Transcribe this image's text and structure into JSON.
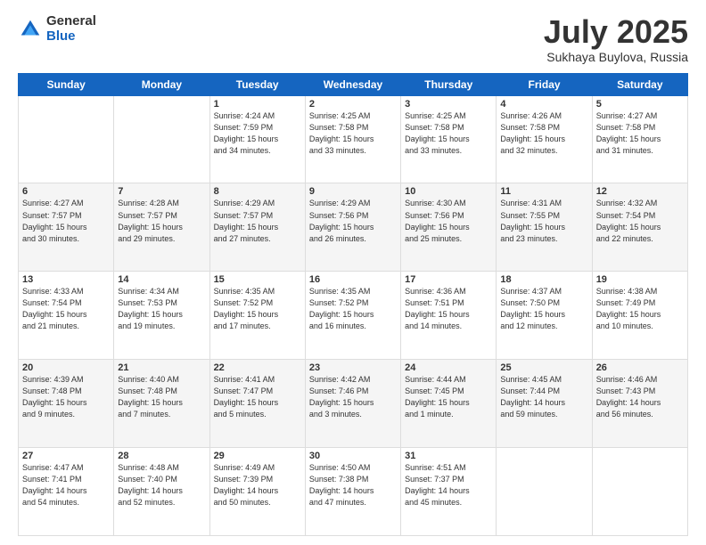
{
  "header": {
    "logo_general": "General",
    "logo_blue": "Blue",
    "month": "July 2025",
    "location": "Sukhaya Buylova, Russia"
  },
  "days_of_week": [
    "Sunday",
    "Monday",
    "Tuesday",
    "Wednesday",
    "Thursday",
    "Friday",
    "Saturday"
  ],
  "weeks": [
    [
      {
        "day": "",
        "info": ""
      },
      {
        "day": "",
        "info": ""
      },
      {
        "day": "1",
        "info": "Sunrise: 4:24 AM\nSunset: 7:59 PM\nDaylight: 15 hours\nand 34 minutes."
      },
      {
        "day": "2",
        "info": "Sunrise: 4:25 AM\nSunset: 7:58 PM\nDaylight: 15 hours\nand 33 minutes."
      },
      {
        "day": "3",
        "info": "Sunrise: 4:25 AM\nSunset: 7:58 PM\nDaylight: 15 hours\nand 33 minutes."
      },
      {
        "day": "4",
        "info": "Sunrise: 4:26 AM\nSunset: 7:58 PM\nDaylight: 15 hours\nand 32 minutes."
      },
      {
        "day": "5",
        "info": "Sunrise: 4:27 AM\nSunset: 7:58 PM\nDaylight: 15 hours\nand 31 minutes."
      }
    ],
    [
      {
        "day": "6",
        "info": "Sunrise: 4:27 AM\nSunset: 7:57 PM\nDaylight: 15 hours\nand 30 minutes."
      },
      {
        "day": "7",
        "info": "Sunrise: 4:28 AM\nSunset: 7:57 PM\nDaylight: 15 hours\nand 29 minutes."
      },
      {
        "day": "8",
        "info": "Sunrise: 4:29 AM\nSunset: 7:57 PM\nDaylight: 15 hours\nand 27 minutes."
      },
      {
        "day": "9",
        "info": "Sunrise: 4:29 AM\nSunset: 7:56 PM\nDaylight: 15 hours\nand 26 minutes."
      },
      {
        "day": "10",
        "info": "Sunrise: 4:30 AM\nSunset: 7:56 PM\nDaylight: 15 hours\nand 25 minutes."
      },
      {
        "day": "11",
        "info": "Sunrise: 4:31 AM\nSunset: 7:55 PM\nDaylight: 15 hours\nand 23 minutes."
      },
      {
        "day": "12",
        "info": "Sunrise: 4:32 AM\nSunset: 7:54 PM\nDaylight: 15 hours\nand 22 minutes."
      }
    ],
    [
      {
        "day": "13",
        "info": "Sunrise: 4:33 AM\nSunset: 7:54 PM\nDaylight: 15 hours\nand 21 minutes."
      },
      {
        "day": "14",
        "info": "Sunrise: 4:34 AM\nSunset: 7:53 PM\nDaylight: 15 hours\nand 19 minutes."
      },
      {
        "day": "15",
        "info": "Sunrise: 4:35 AM\nSunset: 7:52 PM\nDaylight: 15 hours\nand 17 minutes."
      },
      {
        "day": "16",
        "info": "Sunrise: 4:35 AM\nSunset: 7:52 PM\nDaylight: 15 hours\nand 16 minutes."
      },
      {
        "day": "17",
        "info": "Sunrise: 4:36 AM\nSunset: 7:51 PM\nDaylight: 15 hours\nand 14 minutes."
      },
      {
        "day": "18",
        "info": "Sunrise: 4:37 AM\nSunset: 7:50 PM\nDaylight: 15 hours\nand 12 minutes."
      },
      {
        "day": "19",
        "info": "Sunrise: 4:38 AM\nSunset: 7:49 PM\nDaylight: 15 hours\nand 10 minutes."
      }
    ],
    [
      {
        "day": "20",
        "info": "Sunrise: 4:39 AM\nSunset: 7:48 PM\nDaylight: 15 hours\nand 9 minutes."
      },
      {
        "day": "21",
        "info": "Sunrise: 4:40 AM\nSunset: 7:48 PM\nDaylight: 15 hours\nand 7 minutes."
      },
      {
        "day": "22",
        "info": "Sunrise: 4:41 AM\nSunset: 7:47 PM\nDaylight: 15 hours\nand 5 minutes."
      },
      {
        "day": "23",
        "info": "Sunrise: 4:42 AM\nSunset: 7:46 PM\nDaylight: 15 hours\nand 3 minutes."
      },
      {
        "day": "24",
        "info": "Sunrise: 4:44 AM\nSunset: 7:45 PM\nDaylight: 15 hours\nand 1 minute."
      },
      {
        "day": "25",
        "info": "Sunrise: 4:45 AM\nSunset: 7:44 PM\nDaylight: 14 hours\nand 59 minutes."
      },
      {
        "day": "26",
        "info": "Sunrise: 4:46 AM\nSunset: 7:43 PM\nDaylight: 14 hours\nand 56 minutes."
      }
    ],
    [
      {
        "day": "27",
        "info": "Sunrise: 4:47 AM\nSunset: 7:41 PM\nDaylight: 14 hours\nand 54 minutes."
      },
      {
        "day": "28",
        "info": "Sunrise: 4:48 AM\nSunset: 7:40 PM\nDaylight: 14 hours\nand 52 minutes."
      },
      {
        "day": "29",
        "info": "Sunrise: 4:49 AM\nSunset: 7:39 PM\nDaylight: 14 hours\nand 50 minutes."
      },
      {
        "day": "30",
        "info": "Sunrise: 4:50 AM\nSunset: 7:38 PM\nDaylight: 14 hours\nand 47 minutes."
      },
      {
        "day": "31",
        "info": "Sunrise: 4:51 AM\nSunset: 7:37 PM\nDaylight: 14 hours\nand 45 minutes."
      },
      {
        "day": "",
        "info": ""
      },
      {
        "day": "",
        "info": ""
      }
    ]
  ]
}
